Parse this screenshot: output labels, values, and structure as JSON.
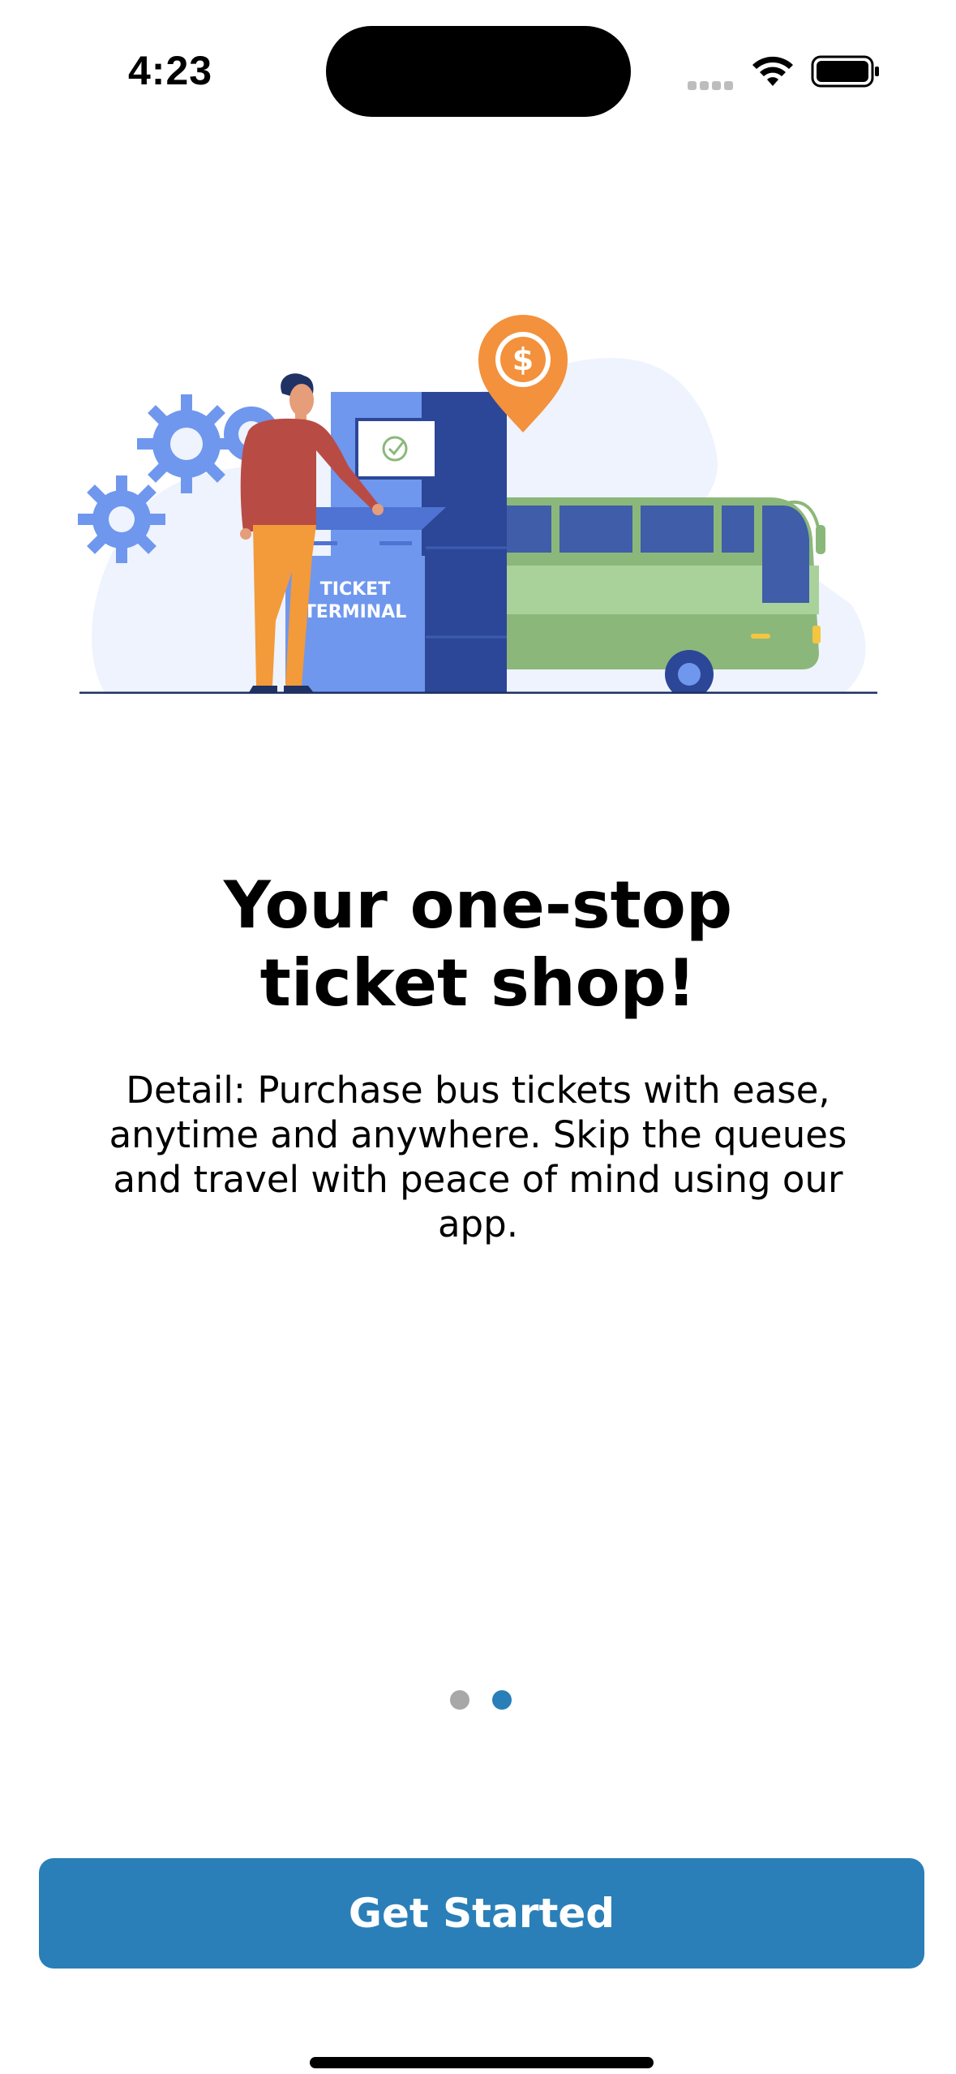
{
  "status_bar": {
    "time": "4:23"
  },
  "illustration": {
    "kiosk_label_line1": "TICKET",
    "kiosk_label_line2": "TERMINAL",
    "pin_symbol": "$",
    "colors": {
      "kiosk_light": "#6f97ee",
      "kiosk_dark": "#2c4797",
      "bus_green": "#8bb87a",
      "bus_light_green": "#a9d29b",
      "pin_orange": "#f3913c",
      "shirt": "#b84c45",
      "pants": "#f39a3a",
      "background_blob": "#eef3fd"
    }
  },
  "onboarding": {
    "title": "Your one-stop\nticket shop!",
    "detail": "Detail: Purchase bus tickets with ease, anytime and anywhere. Skip the queues and travel with peace of mind using our app."
  },
  "pager": {
    "total": 2,
    "current": 2
  },
  "actions": {
    "get_started_label": "Get Started"
  },
  "colors": {
    "accent": "#2a7fb8",
    "dot_inactive": "#a8a8a8"
  }
}
